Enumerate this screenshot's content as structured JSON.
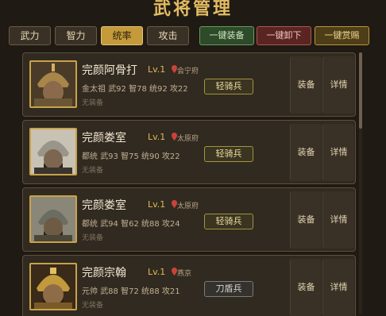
{
  "title": "武将管理",
  "sort_tabs": [
    {
      "label": "武力",
      "active": false
    },
    {
      "label": "智力",
      "active": false
    },
    {
      "label": "统率",
      "active": true
    },
    {
      "label": "攻击",
      "active": false
    }
  ],
  "actions": {
    "equip_all": "一键装备",
    "unequip_all": "一键卸下",
    "reward_all": "一键赏赐"
  },
  "generals": [
    {
      "name": "完颜阿骨打",
      "level": "Lv.1",
      "city": "会宁府",
      "rank": "金太祖",
      "stats": "武92 智78 统92 攻22",
      "equip": "无装备",
      "unit": "轻骑兵",
      "equip_btn": "装备",
      "detail_btn": "详情",
      "helmet_color": "#a8864a",
      "face_color": "#8a6a4a"
    },
    {
      "name": "完颜娄室",
      "level": "Lv.1",
      "city": "太原府",
      "rank": "都统",
      "stats": "武93 智75 统90 攻22",
      "equip": "无装备",
      "unit": "轻骑兵",
      "equip_btn": "装备",
      "detail_btn": "详情",
      "helmet_color": "#9a958a",
      "face_color": "#7c6650"
    },
    {
      "name": "完颜娄室",
      "level": "Lv.1",
      "city": "太原府",
      "rank": "都统",
      "stats": "武94 智62 统88 攻24",
      "equip": "无装备",
      "unit": "轻骑兵",
      "equip_btn": "装备",
      "detail_btn": "详情",
      "helmet_color": "#6c6d62",
      "face_color": "#6f5a44"
    },
    {
      "name": "完颜宗翰",
      "level": "Lv.1",
      "city": "燕京",
      "rank": "元帅",
      "stats": "武88 智72 统88 攻21",
      "equip": "无装备",
      "unit": "刀盾兵",
      "equip_btn": "装备",
      "detail_btn": "详情",
      "helmet_color": "#c29a3c",
      "face_color": "#8e6c48"
    }
  ]
}
